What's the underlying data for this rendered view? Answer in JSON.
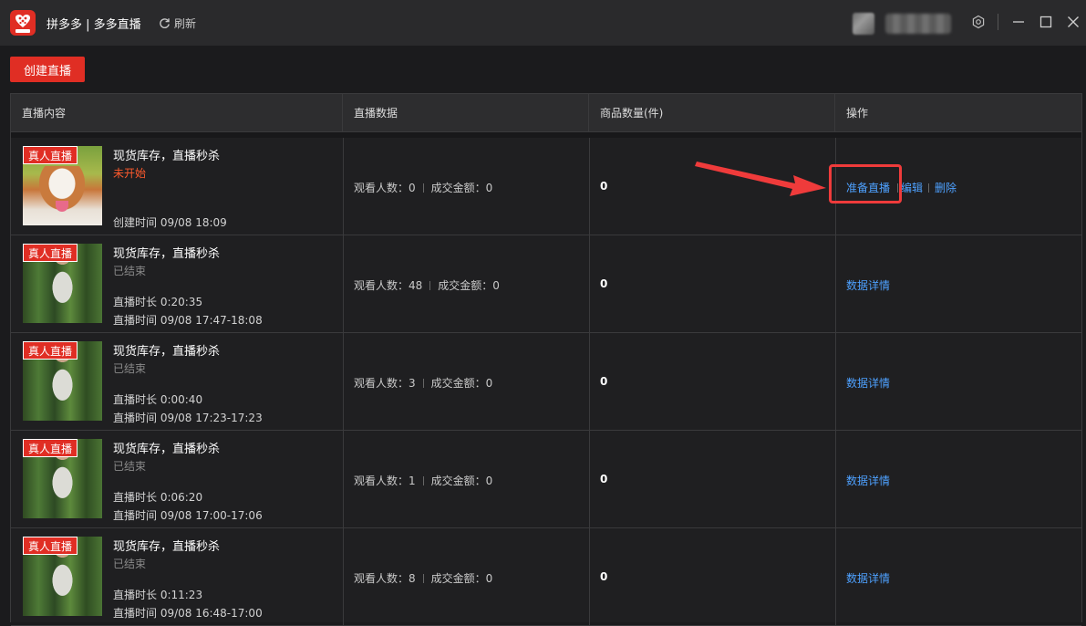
{
  "titlebar": {
    "app_title": "拼多多 | 多多直播",
    "refresh_label": "刷新"
  },
  "toolbar": {
    "create_label": "创建直播"
  },
  "table": {
    "headers": [
      "直播内容",
      "直播数据",
      "商品数量(件)",
      "操作"
    ],
    "rows": [
      {
        "badge": "真人直播",
        "title": "现货库存，直播秒杀",
        "status": "未开始",
        "meta1": "",
        "meta2": "创建时间 09/08 18:09",
        "viewers": "观看人数：0",
        "revenue": "成交金额：0",
        "qty": "0",
        "actions": [
          "准备直播",
          "编辑",
          "删除"
        ]
      },
      {
        "badge": "真人直播",
        "title": "现货库存，直播秒杀",
        "status": "已结束",
        "meta1": "直播时长 0:20:35",
        "meta2": "直播时间 09/08 17:47-18:08",
        "viewers": "观看人数：48",
        "revenue": "成交金额：0",
        "qty": "0",
        "actions": [
          "数据详情"
        ]
      },
      {
        "badge": "真人直播",
        "title": "现货库存，直播秒杀",
        "status": "已结束",
        "meta1": "直播时长 0:00:40",
        "meta2": "直播时间 09/08 17:23-17:23",
        "viewers": "观看人数：3",
        "revenue": "成交金额：0",
        "qty": "0",
        "actions": [
          "数据详情"
        ]
      },
      {
        "badge": "真人直播",
        "title": "现货库存，直播秒杀",
        "status": "已结束",
        "meta1": "直播时长 0:06:20",
        "meta2": "直播时间 09/08 17:00-17:06",
        "viewers": "观看人数：1",
        "revenue": "成交金额：0",
        "qty": "0",
        "actions": [
          "数据详情"
        ]
      },
      {
        "badge": "真人直播",
        "title": "现货库存，直播秒杀",
        "status": "已结束",
        "meta1": "直播时长 0:11:23",
        "meta2": "直播时间 09/08 16:48-17:00",
        "viewers": "观看人数：8",
        "revenue": "成交金额：0",
        "qty": "0",
        "actions": [
          "数据详情"
        ]
      }
    ]
  },
  "colors": {
    "brand": "#e02e24",
    "link": "#4ea1ff",
    "pending": "#ff5a2d",
    "annotation": "#ef3b3b"
  }
}
